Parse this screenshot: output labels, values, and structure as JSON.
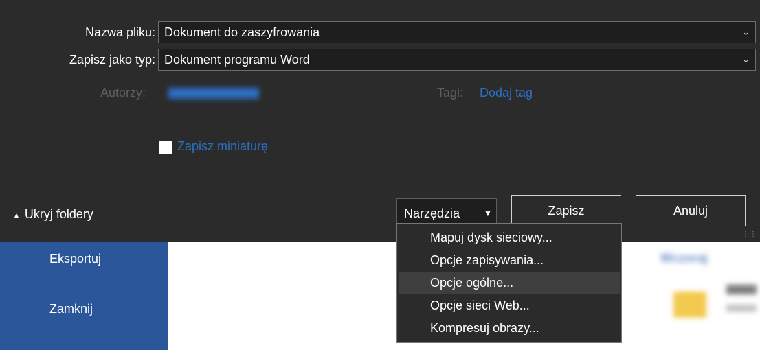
{
  "backstage": {
    "items": [
      {
        "label": "Eksportuj"
      },
      {
        "label": "Zamknij"
      }
    ],
    "recent_heading": "Wczoraj"
  },
  "dialog": {
    "filename_label": "Nazwa pliku:",
    "filename_value": "Dokument do zaszyfrowania",
    "type_label": "Zapisz jako typ:",
    "type_value": "Dokument programu Word",
    "authors_label": "Autorzy:",
    "tags_label": "Tagi:",
    "tags_link": "Dodaj tag",
    "thumbnail_label": "Zapisz miniaturę",
    "hide_folders": "Ukryj foldery",
    "tools_label": "Narzędzia",
    "save_label": "Zapisz",
    "cancel_label": "Anuluj"
  },
  "tools_menu": {
    "items": [
      {
        "label": "Mapuj dysk sieciowy..."
      },
      {
        "label": "Opcje zapisywania..."
      },
      {
        "label": "Opcje ogólne..."
      },
      {
        "label": "Opcje sieci Web..."
      },
      {
        "label": "Kompresuj obrazy..."
      }
    ]
  },
  "icons": {
    "chevron": "chevron-down-icon",
    "caret": "caret-down-icon",
    "toggle": "chevron-up-icon"
  },
  "colors": {
    "dialog_bg": "#2b2b2b",
    "sidebar_blue": "#2b579a",
    "link_blue": "#2d6fc4",
    "menu_hover": "#3f3f3f"
  }
}
